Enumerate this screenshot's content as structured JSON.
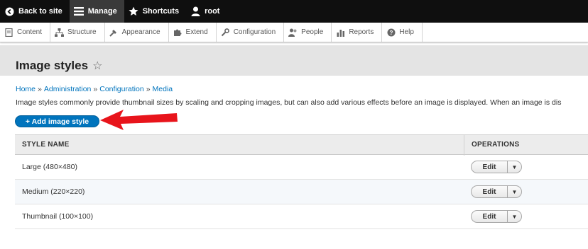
{
  "toolbar": {
    "back_label": "Back to site",
    "manage_label": "Manage",
    "shortcuts_label": "Shortcuts",
    "user_label": "root"
  },
  "tray": {
    "items": [
      {
        "label": "Content",
        "icon": "content-icon"
      },
      {
        "label": "Structure",
        "icon": "structure-icon"
      },
      {
        "label": "Appearance",
        "icon": "appearance-icon"
      },
      {
        "label": "Extend",
        "icon": "extend-icon"
      },
      {
        "label": "Configuration",
        "icon": "wrench-icon"
      },
      {
        "label": "People",
        "icon": "people-icon"
      },
      {
        "label": "Reports",
        "icon": "reports-icon"
      },
      {
        "label": "Help",
        "icon": "help-icon"
      }
    ]
  },
  "page": {
    "title": "Image styles",
    "breadcrumb": [
      "Home",
      "Administration",
      "Configuration",
      "Media"
    ],
    "description": "Image styles commonly provide thumbnail sizes by scaling and cropping images, but can also add various effects before an image is displayed. When an image is dis",
    "add_button": "+ Add image style"
  },
  "table": {
    "headers": {
      "name": "STYLE NAME",
      "operations": "OPERATIONS"
    },
    "rows": [
      {
        "name": "Large (480×480)",
        "edit": "Edit"
      },
      {
        "name": "Medium (220×220)",
        "edit": "Edit"
      },
      {
        "name": "Thumbnail (100×100)",
        "edit": "Edit"
      }
    ]
  },
  "colors": {
    "accent": "#0074bd",
    "toolbar_bg": "#0f0f0f",
    "arrow": "#e8141b"
  }
}
